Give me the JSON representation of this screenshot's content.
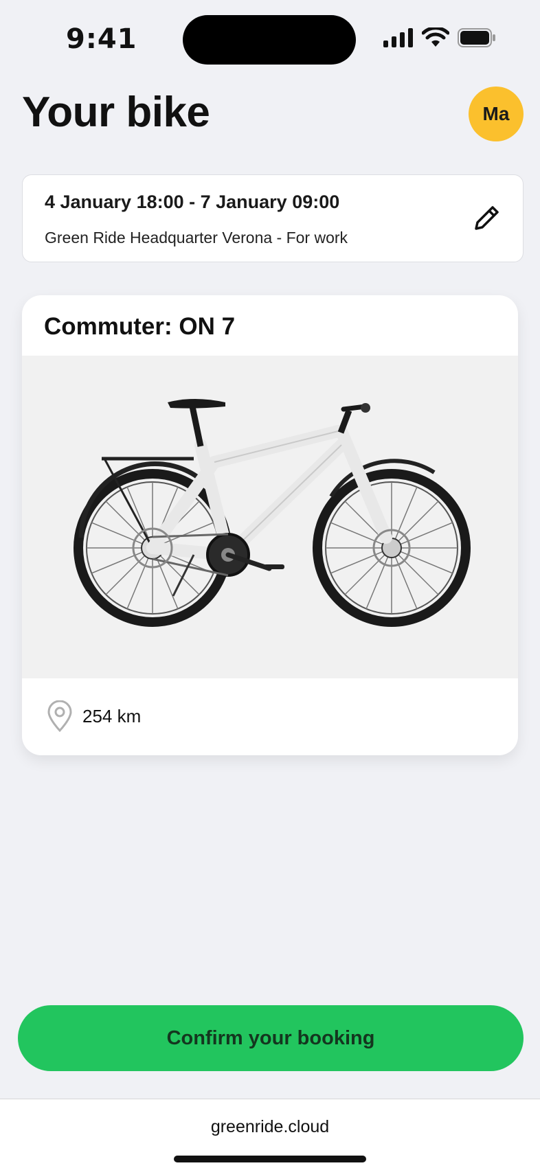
{
  "status_bar": {
    "time": "9:41"
  },
  "header": {
    "title": "Your bike",
    "avatar_initials": "Ma"
  },
  "booking": {
    "dates": "4 January 18:00 - 7 January 09:00",
    "location": "Green Ride Headquarter Verona - For work",
    "edit_icon": "pencil-icon"
  },
  "bike": {
    "name": "Commuter: ON 7",
    "distance": "254 km",
    "distance_icon": "location-pin-icon"
  },
  "actions": {
    "confirm_label": "Confirm your booking"
  },
  "browser": {
    "url": "greenride.cloud"
  },
  "colors": {
    "accent": "#22c55e",
    "avatar": "#fbc02d",
    "background": "#f0f1f5"
  }
}
